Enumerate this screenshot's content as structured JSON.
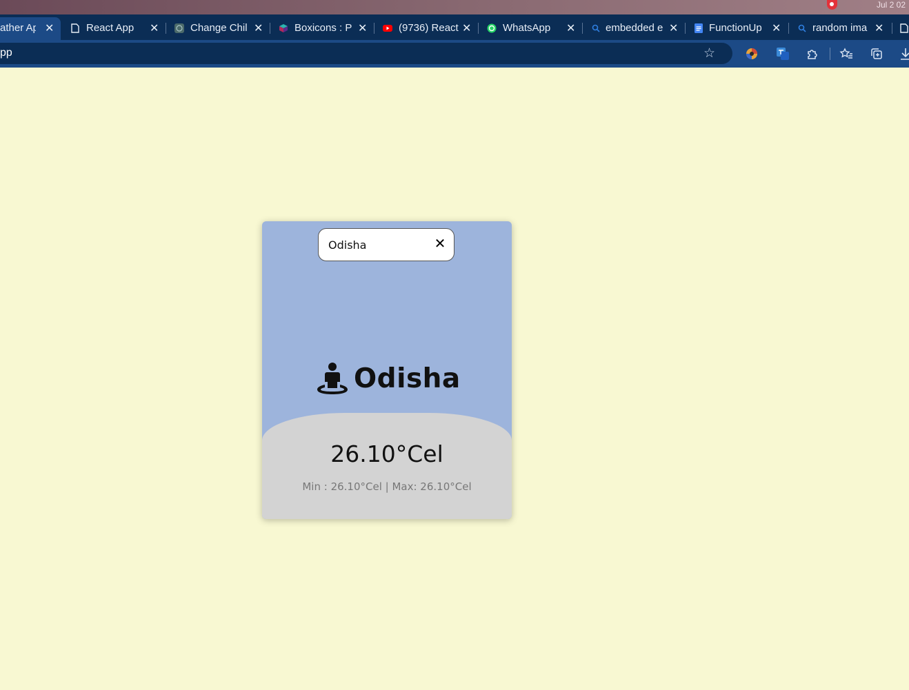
{
  "os": {
    "clock": "Jul 2  02"
  },
  "tabs": [
    {
      "title": "ather App",
      "active": true,
      "icon": "none"
    },
    {
      "title": "React App",
      "active": false,
      "icon": "page-icon"
    },
    {
      "title": "Change Chil",
      "active": false,
      "icon": "chatgpt-icon"
    },
    {
      "title": "Boxicons : P",
      "active": false,
      "icon": "boxicons-icon"
    },
    {
      "title": "(9736) React",
      "active": false,
      "icon": "youtube-icon"
    },
    {
      "title": "WhatsApp",
      "active": false,
      "icon": "whatsapp-icon"
    },
    {
      "title": "embedded e",
      "active": false,
      "icon": "search-icon"
    },
    {
      "title": "FunctionUp",
      "active": false,
      "icon": "docs-icon"
    },
    {
      "title": "random ima",
      "active": false,
      "icon": "search-icon"
    }
  ],
  "toolbar": {
    "url": "pp"
  },
  "search": {
    "value": "Odisha",
    "placeholder": "",
    "clear_glyph": "✕"
  },
  "weather": {
    "city": "Odisha",
    "temp": "26.10°Cel",
    "minmax": "Min : 26.10°Cel | Max: 26.10°Cel"
  },
  "colors": {
    "page_bg": "#f8f8d2",
    "card_top": "#9db4dc",
    "card_bottom": "#d3d3d3",
    "tabstrip": "#0b2d55",
    "toolbar": "#1c4a86"
  }
}
